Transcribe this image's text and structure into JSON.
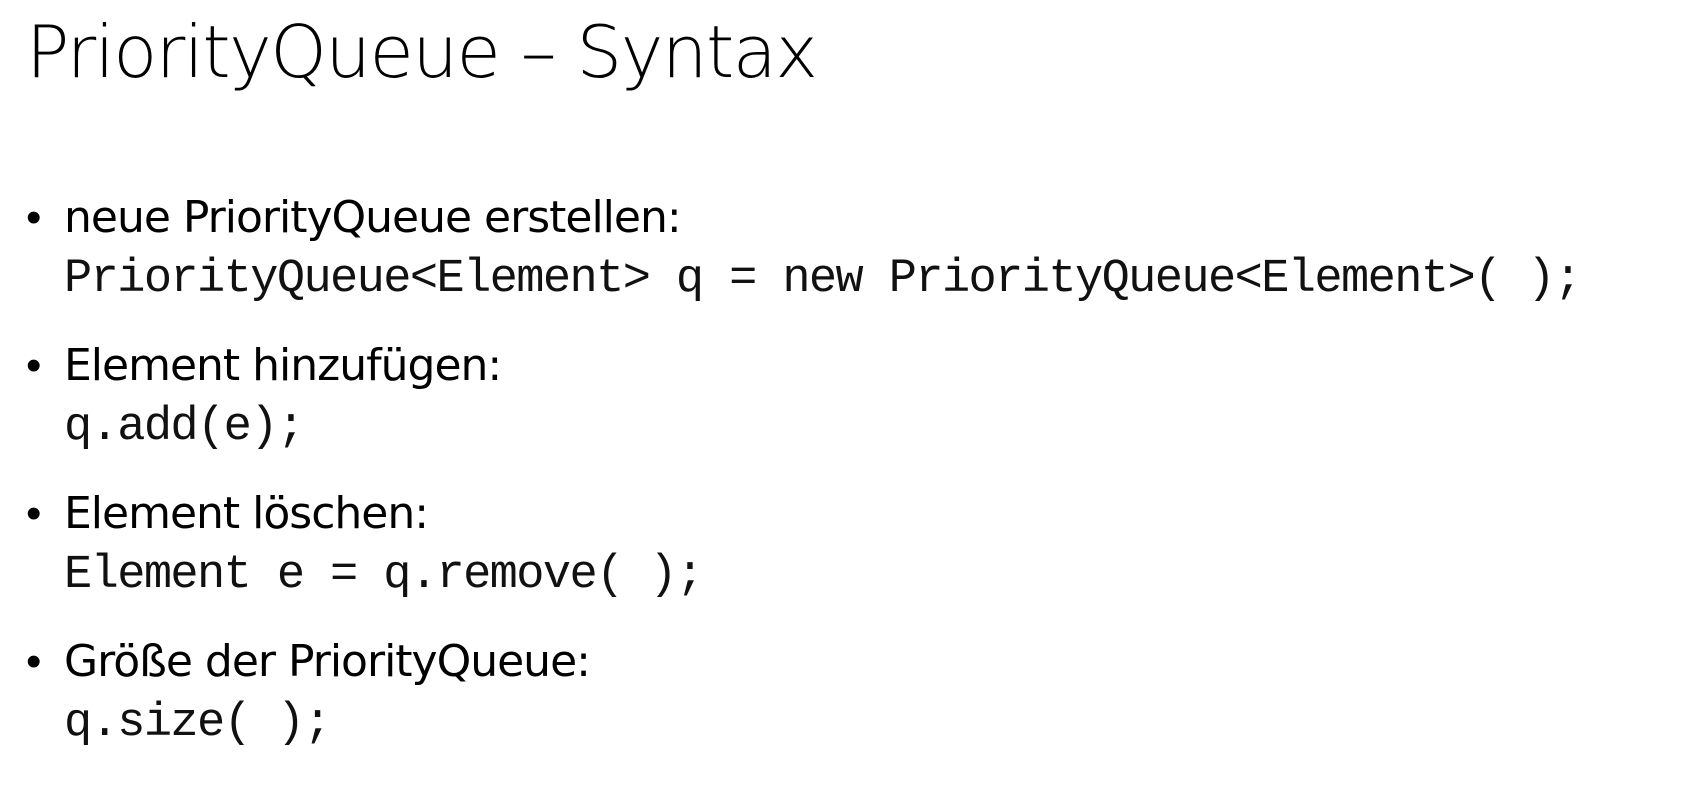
{
  "slide": {
    "title": "PriorityQueue – Syntax",
    "items": [
      {
        "bullet": "•",
        "heading": "neue PriorityQueue erstellen:",
        "code": "PriorityQueue<Element> q = new PriorityQueue<Element>( );"
      },
      {
        "bullet": "•",
        "heading": "Element hinzufügen:",
        "code": "q.add(e);"
      },
      {
        "bullet": "•",
        "heading": "Element löschen:",
        "code": "Element e = q.remove( );"
      },
      {
        "bullet": "•",
        "heading": "Größe der PriorityQueue:",
        "code": "q.size( );"
      }
    ]
  }
}
